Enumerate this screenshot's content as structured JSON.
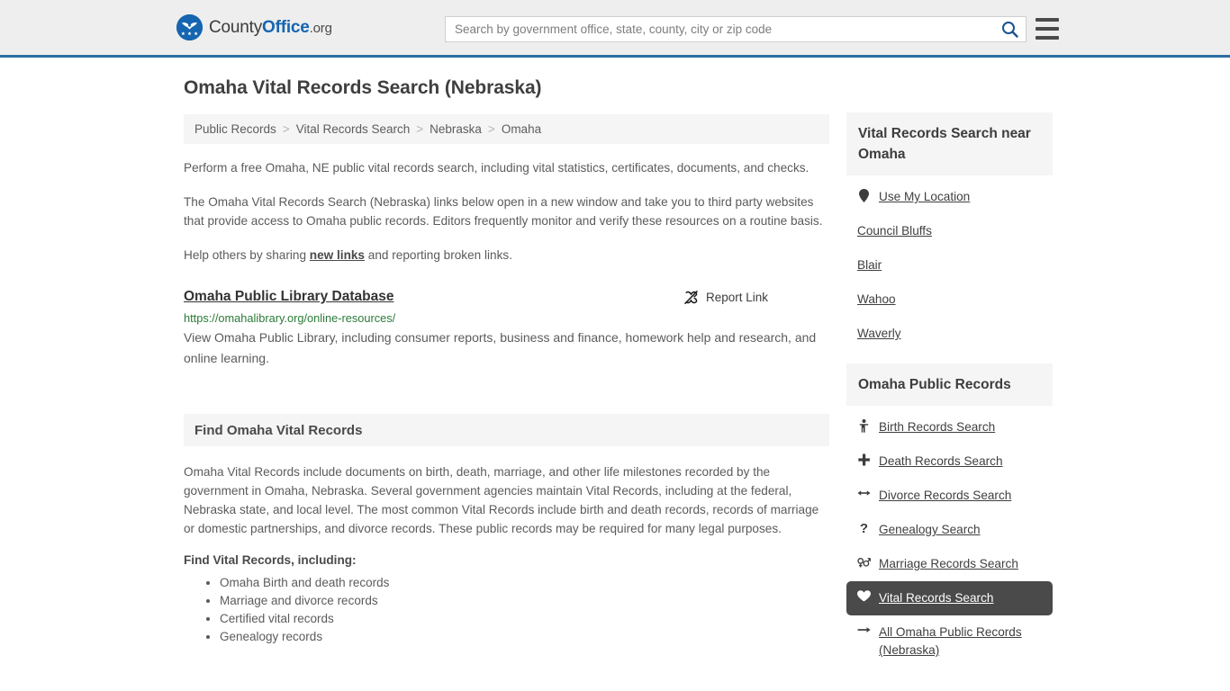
{
  "header": {
    "logo": {
      "part1": "County",
      "part2": "Office",
      "tld": ".org",
      "icon": "eagle-seal-icon"
    },
    "search": {
      "placeholder": "Search by government office, state, county, city or zip code",
      "value": "",
      "button_icon": "search-icon"
    },
    "menu_icon": "hamburger-menu-icon",
    "accent_color": "#2e6da4",
    "background": "#eeeeee"
  },
  "main": {
    "title": "Omaha Vital Records Search (Nebraska)",
    "breadcrumb": [
      {
        "label": "Public Records"
      },
      {
        "label": "Vital Records Search"
      },
      {
        "label": "Nebraska"
      },
      {
        "label": "Omaha"
      }
    ],
    "breadcrumb_separator": ">",
    "paragraphs": {
      "intro": "Perform a free Omaha, NE public vital records search, including vital statistics, certificates, documents, and checks.",
      "disclaimer": "The Omaha Vital Records Search (Nebraska) links below open in a new window and take you to third party websites that provide access to Omaha public records. Editors frequently monitor and verify these resources on a routine basis.",
      "help_prefix": "Help others by sharing ",
      "help_link": "new links",
      "help_suffix": " and reporting broken links."
    },
    "result": {
      "title": "Omaha Public Library Database",
      "report_label": "Report Link",
      "report_icon": "broken-link-icon",
      "url": "https://omahalibrary.org/online-resources/",
      "description": "View Omaha Public Library, including consumer reports, business and finance, homework help and research, and online learning."
    },
    "section": {
      "heading": "Find Omaha Vital Records",
      "body": "Omaha Vital Records include documents on birth, death, marriage, and other life milestones recorded by the government in Omaha, Nebraska. Several government agencies maintain Vital Records, including at the federal, Nebraska state, and local level. The most common Vital Records include birth and death records, records of marriage or domestic partnerships, and divorce records. These public records may be required for many legal purposes.",
      "list_heading": "Find Vital Records, including:",
      "list_items": [
        "Omaha Birth and death records",
        "Marriage and divorce records",
        "Certified vital records",
        "Genealogy records"
      ]
    }
  },
  "sidebar": {
    "nearby": {
      "heading": "Vital Records Search near Omaha",
      "items": [
        {
          "label": "Use My Location",
          "icon": "map-pin-icon",
          "has_icon": true
        },
        {
          "label": "Council Bluffs",
          "icon": "",
          "has_icon": false
        },
        {
          "label": "Blair",
          "icon": "",
          "has_icon": false
        },
        {
          "label": "Wahoo",
          "icon": "",
          "has_icon": false
        },
        {
          "label": "Waverly",
          "icon": "",
          "has_icon": false
        }
      ]
    },
    "public_records": {
      "heading": "Omaha Public Records",
      "items": [
        {
          "label": "Birth Records Search",
          "icon": "baby-icon",
          "glyph": "$",
          "active": false
        },
        {
          "label": "Death Records Search",
          "icon": "cross-icon",
          "glyph": "✚",
          "active": false
        },
        {
          "label": "Divorce Records Search",
          "icon": "two-way-arrow-icon",
          "glyph": "↔",
          "active": false
        },
        {
          "label": "Genealogy Search",
          "icon": "question-mark-icon",
          "glyph": "?",
          "active": false
        },
        {
          "label": "Marriage Records Search",
          "icon": "gender-symbols-icon",
          "glyph": "⚥",
          "active": false
        },
        {
          "label": "Vital Records Search",
          "icon": "heart-icon",
          "glyph": "♥",
          "active": true
        },
        {
          "label": "All Omaha Public Records (Nebraska)",
          "icon": "arrow-right-icon",
          "glyph": "→",
          "active": false
        }
      ],
      "active_background": "#4a4a4a"
    }
  },
  "colors": {
    "link_green": "#2b7a38",
    "text": "#5b5b5b",
    "panel_bg": "#f5f5f5"
  }
}
